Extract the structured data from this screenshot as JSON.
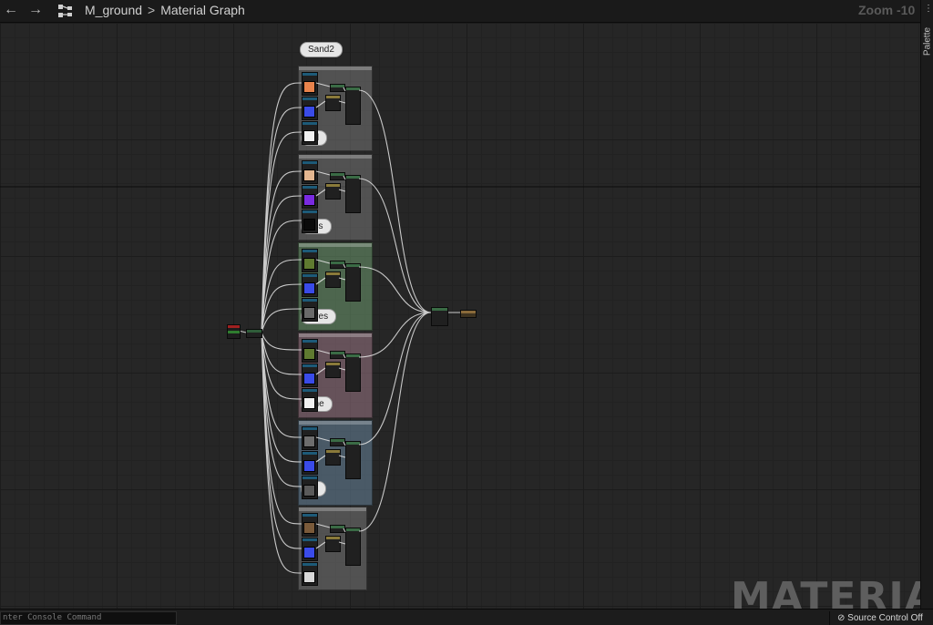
{
  "toolbar": {
    "back_icon": "arrow-left-icon",
    "forward_icon": "arrow-right-icon",
    "graph_icon": "graph-icon",
    "asset_name": "M_ground",
    "separator": ">",
    "graph_name": "Material Graph",
    "zoom": "Zoom -10"
  },
  "palette": {
    "label": "Palette",
    "icon": "menu-icon"
  },
  "comments": [
    {
      "label": "Sand2",
      "color": "#8a8a8a"
    },
    {
      "label": "nd",
      "color": "#8a8a8a"
    },
    {
      "label": "ass",
      "color": "#8a8a8a"
    },
    {
      "label": "aves",
      "color": "#6e9a70"
    },
    {
      "label": "one",
      "color": "#9b7785"
    },
    {
      "label": "ck",
      "color": "#637d93"
    }
  ],
  "colors": {
    "wire": "#e8e8e8",
    "orange": "#e8834c",
    "peach": "#e3b690",
    "blue": "#3a4be8",
    "purple": "#7a2ae0",
    "green_tex": "#5f7a30",
    "dark": "#0b0b0b"
  },
  "watermark": "MATERIAL",
  "status": {
    "console_placeholder": "nter Console Command",
    "source_control": "Source Control Off",
    "source_control_icon": "no-entry-icon"
  }
}
